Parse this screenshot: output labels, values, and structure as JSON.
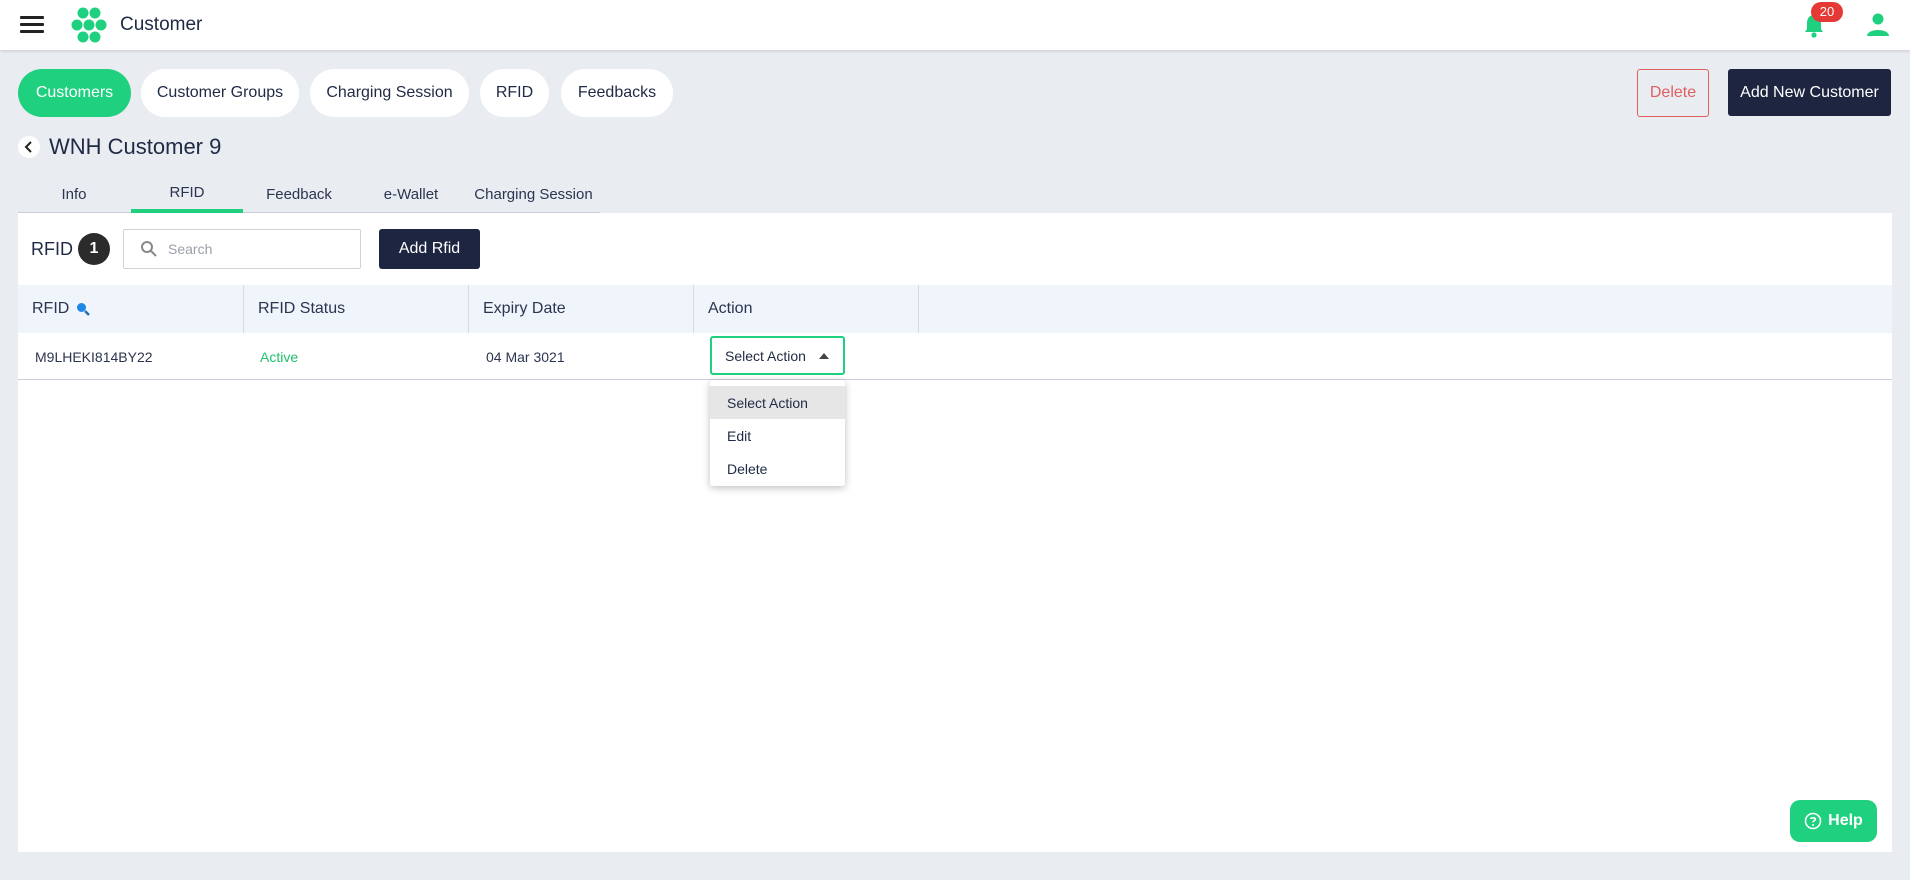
{
  "header": {
    "app_title": "Customer",
    "notification_count": "20",
    "icons": [
      "menu-icon",
      "logo-icon",
      "bell-icon",
      "user-icon"
    ]
  },
  "nav": {
    "pills": [
      {
        "label": "Customers",
        "active": true
      },
      {
        "label": "Customer Groups"
      },
      {
        "label": "Charging Session"
      },
      {
        "label": "RFID"
      },
      {
        "label": "Feedbacks"
      }
    ],
    "delete_label": "Delete",
    "add_customer_label": "Add New Customer"
  },
  "page": {
    "title": "WNH Customer 9",
    "tabs": [
      {
        "label": "Info"
      },
      {
        "label": "RFID",
        "active": true
      },
      {
        "label": "Feedback"
      },
      {
        "label": "e-Wallet"
      },
      {
        "label": "Charging Session"
      }
    ]
  },
  "rfid_panel": {
    "heading": "RFID",
    "count": "1",
    "search_placeholder": "Search",
    "add_label": "Add Rfid",
    "columns": [
      "RFID",
      "RFID Status",
      "Expiry Date",
      "Action"
    ],
    "rows": [
      {
        "rfid": "M9LHEKI814BY22",
        "status": "Active",
        "expiry": "04 Mar 3021",
        "action": "Select Action"
      }
    ],
    "action_menu": [
      "Select Action",
      "Edit",
      "Delete"
    ]
  },
  "help_label": "Help",
  "colors": {
    "accent": "#1fd07f",
    "dark": "#1d2540",
    "danger": "#e06060",
    "badge": "#e53935",
    "background": "#e9ecf1"
  }
}
